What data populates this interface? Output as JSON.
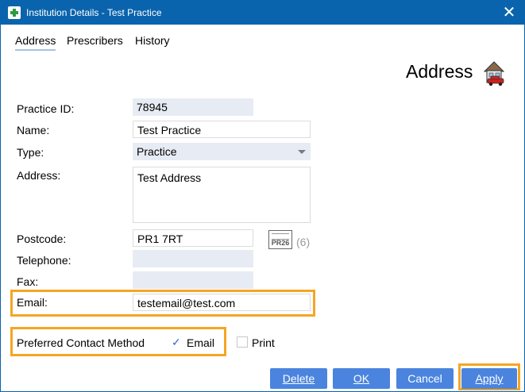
{
  "window": {
    "title": "Institution Details - Test Practice",
    "close_glyph": "✕"
  },
  "tabs": [
    {
      "label": "Address",
      "active": true
    },
    {
      "label": "Prescribers",
      "active": false
    },
    {
      "label": "History",
      "active": false
    }
  ],
  "section": {
    "title": "Address",
    "icon": "house-with-car-icon"
  },
  "form": {
    "practice_id": {
      "label": "Practice ID:",
      "value": "78945"
    },
    "name": {
      "label": "Name:",
      "value": "Test Practice"
    },
    "type": {
      "label": "Type:",
      "value": "Practice"
    },
    "address": {
      "label": "Address:",
      "value": "Test Address"
    },
    "postcode": {
      "label": "Postcode:",
      "value": "PR1 7RT",
      "pr26_label": "PR26",
      "pr26_count": "(6)"
    },
    "telephone": {
      "label": "Telephone:",
      "value": ""
    },
    "fax": {
      "label": "Fax:",
      "value": ""
    },
    "email": {
      "label": "Email:",
      "value": "testemail@test.com"
    }
  },
  "contact": {
    "label": "Preferred Contact Method",
    "email": {
      "label": "Email",
      "checked": true,
      "glyph": "✓"
    },
    "print": {
      "label": "Print",
      "checked": false
    }
  },
  "buttons": {
    "delete": "Delete",
    "ok": "OK",
    "cancel": "Cancel",
    "apply": "Apply"
  },
  "colors": {
    "title_bar": "#0a64ad",
    "button": "#4a84de",
    "highlight": "#f5a623",
    "readonly_field": "#e7ebf3"
  }
}
